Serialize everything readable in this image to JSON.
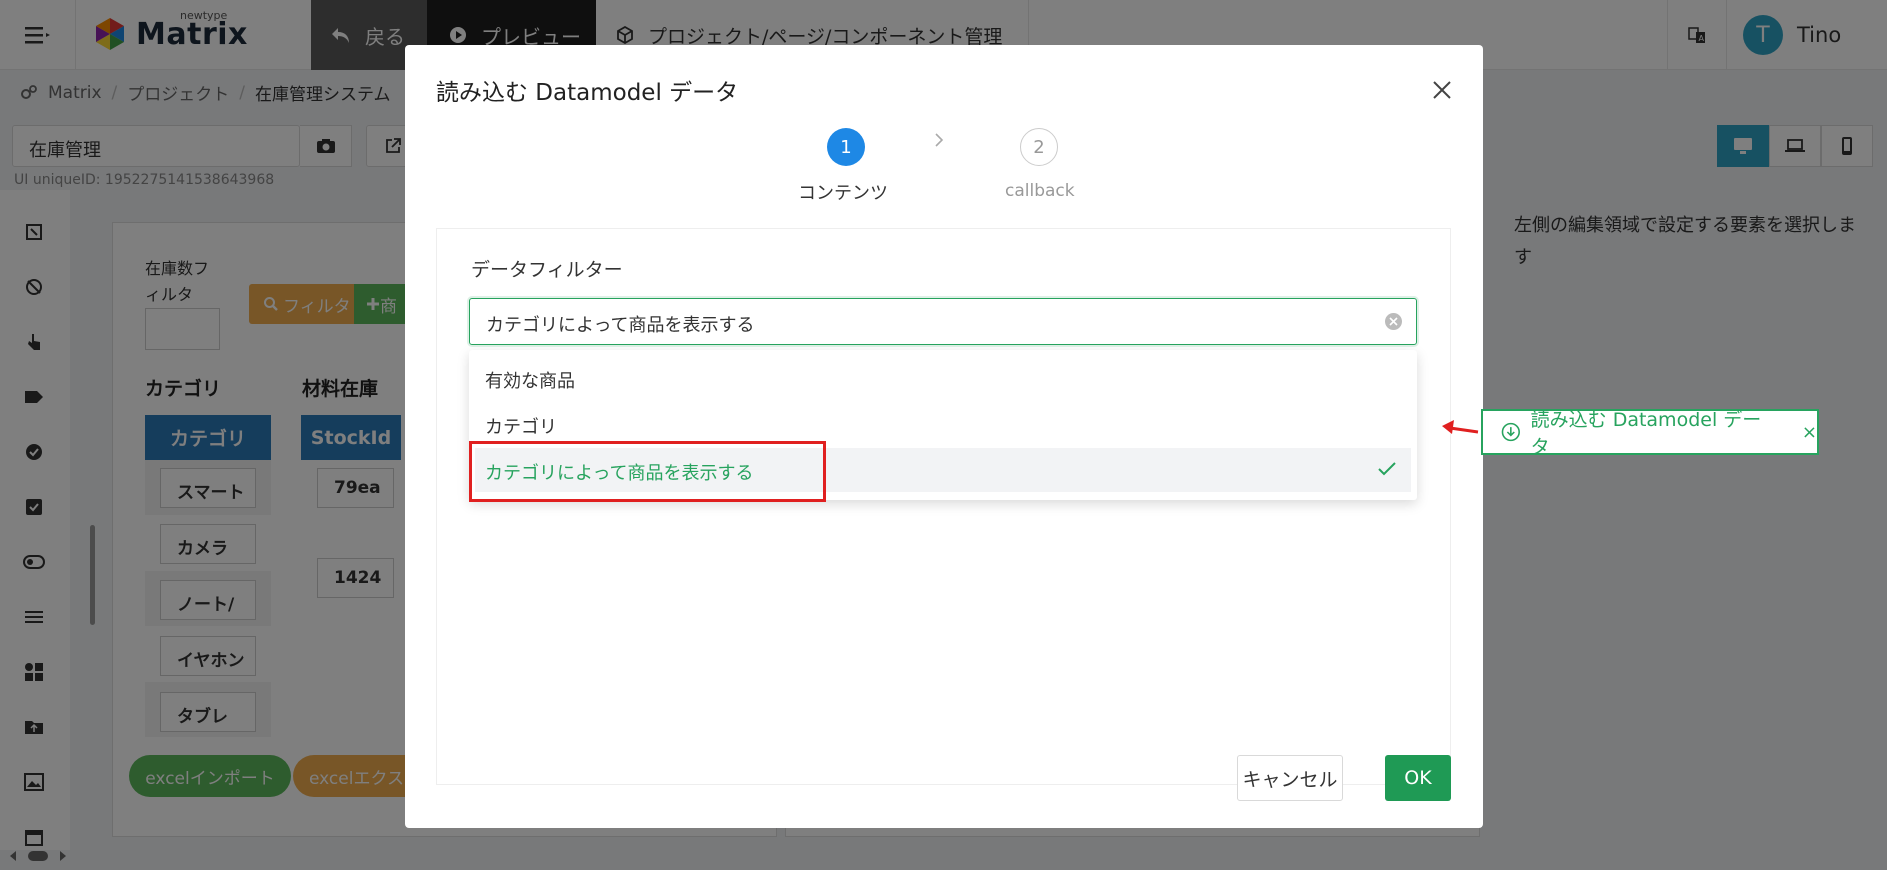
{
  "topbar": {
    "logo_text": "Matrix",
    "logo_sub": "newtype",
    "back_label": "戻る",
    "preview_label": "プレビュー",
    "manage_label": "プロジェクト/ページ/コンポーネント管理",
    "avatar_letter": "T",
    "user_name": "Tino"
  },
  "breadcrumb": {
    "items": [
      "Matrix",
      "プロジェクト",
      "在庫管理システム"
    ],
    "separator": "/"
  },
  "toolbar": {
    "page_name": "在庫管理",
    "ui_unique_id": "UI uniqueID: 1952275141538643968"
  },
  "canvas": {
    "stock_filter_label_1": "在庫数フ",
    "stock_filter_label_2": "ィルタ",
    "filter_button": "フィルタ",
    "add_button": "商",
    "category_title": "カテゴリ",
    "material_title": "材料在庫",
    "category_header": "カテゴリ",
    "stock_header": "StockId",
    "category_rows": [
      "スマート",
      "カメラ",
      "ノート/",
      "イヤホン",
      "タブレ"
    ],
    "stock_rows": [
      "79ea",
      "1424"
    ],
    "excel_import": "excelインポート",
    "excel_export": "excelエクス"
  },
  "right_panel": {
    "hint": "左側の編集領域で設定する要素を選択します"
  },
  "modal": {
    "title": "読み込む Datamodel データ",
    "steps": [
      {
        "number": "1",
        "label": "コンテンツ"
      },
      {
        "number": "2",
        "label": "callback"
      }
    ],
    "filter_label": "データフィルター",
    "selected_value": "カテゴリによって商品を表示する",
    "options": [
      "有効な商品",
      "カテゴリ",
      "カテゴリによって商品を表示する"
    ],
    "cancel_label": "キャンセル",
    "ok_label": "OK"
  },
  "tag": {
    "label": "読み込む Datamodel データ",
    "close": "×"
  },
  "colors": {
    "accent_green": "#27a35e",
    "step_blue": "#1e88e5",
    "highlight_red": "#e02020",
    "device_active": "#2fa3c4"
  }
}
